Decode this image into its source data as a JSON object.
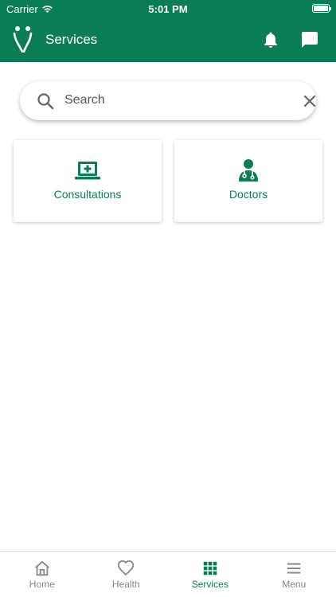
{
  "status_bar": {
    "carrier": "Carrier",
    "time": "5:01 PM"
  },
  "header": {
    "title": "Services",
    "icons": [
      "logo-icon",
      "bell-icon",
      "chat-icon"
    ]
  },
  "search": {
    "placeholder": "Search",
    "value": ""
  },
  "services": [
    {
      "label": "Consultations",
      "icon": "laptop-plus-icon"
    },
    {
      "label": "Doctors",
      "icon": "doctor-icon"
    }
  ],
  "tabs": [
    {
      "label": "Home",
      "icon": "home-icon",
      "active": false
    },
    {
      "label": "Health",
      "icon": "heart-icon",
      "active": false
    },
    {
      "label": "Services",
      "icon": "grid-icon",
      "active": true
    },
    {
      "label": "Menu",
      "icon": "menu-icon",
      "active": false
    }
  ],
  "colors": {
    "primary": "#0b7c57",
    "inactive": "#888888",
    "background": "#ffffff"
  }
}
